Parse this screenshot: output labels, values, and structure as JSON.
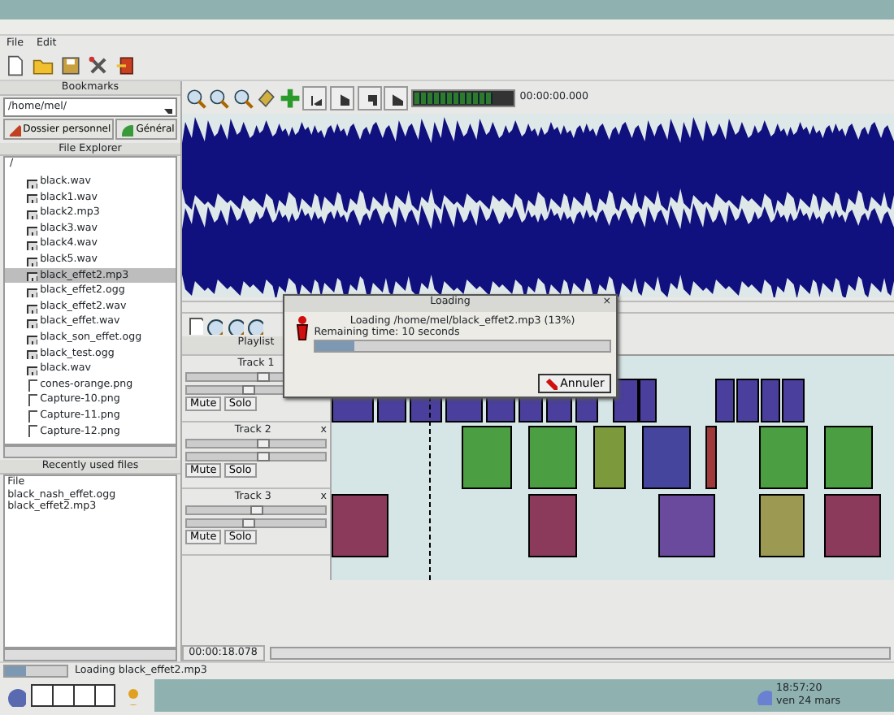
{
  "menu": [
    "File",
    "Edit"
  ],
  "bookmarks": {
    "title": "Bookmarks",
    "path": "/home/mel/",
    "buttons": [
      "Dossier personnel",
      "Général"
    ]
  },
  "explorer": {
    "title": "File Explorer",
    "root": "/",
    "files": [
      {
        "name": "black.wav",
        "kind": "audio",
        "selected": false
      },
      {
        "name": "black1.wav",
        "kind": "audio",
        "selected": false
      },
      {
        "name": "black2.mp3",
        "kind": "audio",
        "selected": false
      },
      {
        "name": "black3.wav",
        "kind": "audio",
        "selected": false
      },
      {
        "name": "black4.wav",
        "kind": "audio",
        "selected": false
      },
      {
        "name": "black5.wav",
        "kind": "audio",
        "selected": false
      },
      {
        "name": "black_effet2.mp3",
        "kind": "audio",
        "selected": true
      },
      {
        "name": "black_effet2.ogg",
        "kind": "audio",
        "selected": false
      },
      {
        "name": "black_effet2.wav",
        "kind": "audio",
        "selected": false
      },
      {
        "name": "black_effet.wav",
        "kind": "audio",
        "selected": false
      },
      {
        "name": "black_son_effet.ogg",
        "kind": "audio",
        "selected": false
      },
      {
        "name": "black_test.ogg",
        "kind": "audio",
        "selected": false
      },
      {
        "name": "black.wav",
        "kind": "audio",
        "selected": false
      },
      {
        "name": "cones-orange.png",
        "kind": "file",
        "selected": false
      },
      {
        "name": "Capture-10.png",
        "kind": "file",
        "selected": false
      },
      {
        "name": "Capture-11.png",
        "kind": "file",
        "selected": false
      },
      {
        "name": "Capture-12.png",
        "kind": "file",
        "selected": false
      }
    ]
  },
  "recent": {
    "title": "Recently used files",
    "header": "File",
    "files": [
      "black_nash_effet.ogg",
      "black_effet2.mp3"
    ]
  },
  "meter": {
    "level": 0.8,
    "reading": "00:00:00.000"
  },
  "playlist": {
    "title": "Playlist",
    "tracks": [
      {
        "name": "Track 1",
        "mute": "Mute",
        "solo": "Solo",
        "sliders": [
          {
            "level": 0.55
          },
          {
            "level": 0.45
          }
        ],
        "clips": [
          {
            "color": "#4a3f9c"
          },
          {
            "color": "#4a3f9c"
          },
          {
            "color": "#4a3f9c"
          },
          {
            "color": "#4a3f9c"
          },
          {
            "color": "#4a3f9c"
          },
          {
            "color": "#4a3f9c"
          },
          {
            "color": "#4a3f9c"
          },
          {
            "color": "#4a3f9c"
          },
          {
            "color": "#4a3f9c"
          },
          {
            "color": "#4a3f9c"
          },
          {
            "color": "#4a3f9c"
          },
          {
            "color": "#4a3f9c"
          },
          {
            "color": "#4a3f9c"
          },
          {
            "color": "#4a3f9c"
          }
        ]
      },
      {
        "name": "Track 2",
        "close": "x",
        "mute": "Mute",
        "solo": "Solo",
        "sliders": [
          {
            "level": 0.55
          },
          {
            "level": 0.55
          }
        ],
        "clips": [
          {
            "color": "#4c9e42"
          },
          {
            "color": "#4c9e42"
          },
          {
            "color": "#7c9a3c"
          },
          {
            "color": "#45459e"
          },
          {
            "color": "#a03a3a"
          },
          {
            "color": "#4c9e42"
          },
          {
            "color": "#4c9e42"
          }
        ]
      },
      {
        "name": "Track 3",
        "close": "x",
        "mute": "Mute",
        "solo": "Solo",
        "sliders": [
          {
            "level": 0.5
          },
          {
            "level": 0.45
          }
        ],
        "clips": [
          {
            "color": "#8c3a5c"
          },
          {
            "color": "#8c3a5c"
          },
          {
            "color": "#6a4a9c"
          },
          {
            "color": "#9c9a52"
          },
          {
            "color": "#8c3a5c"
          }
        ]
      }
    ],
    "time": "00:00:18.078"
  },
  "dialog": {
    "title": "Loading",
    "close": "×",
    "message": "Loading /home/mel/black_effet2.mp3 (13%)",
    "remaining": "Remaining time: 10 seconds",
    "level": 0.13,
    "button": "Annuler"
  },
  "status": {
    "level": 0.35,
    "text": "Loading black_effet2.mp3"
  },
  "taskbar": {
    "time": "18:57:20",
    "date": "ven 24 mars"
  }
}
